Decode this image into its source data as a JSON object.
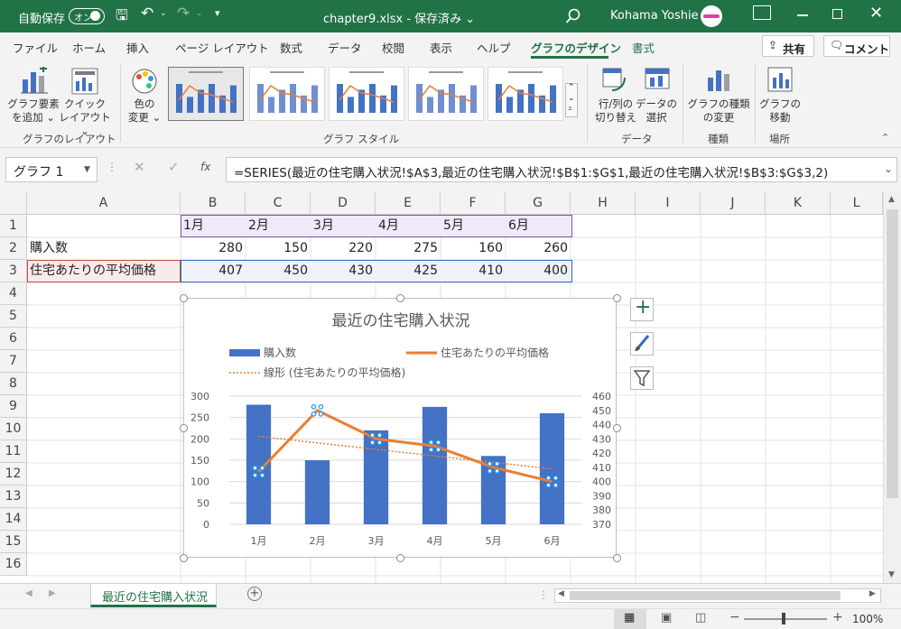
{
  "title_bar": {
    "autosave_label": "自動保存",
    "autosave_state": "オン",
    "filename": "chapter9.xlsx - 保存済み ⌄",
    "user": "Kohama Yoshie"
  },
  "menu": {
    "tabs": [
      "ファイル",
      "ホーム",
      "挿入",
      "ページ レイアウト",
      "数式",
      "データ",
      "校閲",
      "表示",
      "ヘルプ",
      "グラフのデザイン",
      "書式"
    ],
    "share": "共有",
    "comment": "コメント"
  },
  "ribbon": {
    "add_element": "グラフ要素\nを追加 ⌄",
    "quick_layout": "クイック\nレイアウト ⌄",
    "change_color": "色の\n変更 ⌄",
    "switch_rowcol": "行/列の\n切り替え",
    "select_data": "データの\n選択",
    "change_type": "グラフの種類\nの変更",
    "move_chart": "グラフの\n移動",
    "group_layout": "グラフのレイアウト",
    "group_style": "グラフ スタイル",
    "group_data": "データ",
    "group_type": "種類",
    "group_location": "場所"
  },
  "formula_bar": {
    "name_box": "グラフ 1",
    "fx": "fx",
    "formula": "=SERIES(最近の住宅購入状況!$A$3,最近の住宅購入状況!$B$1:$G$1,最近の住宅購入状況!$B$3:$G$3,2)"
  },
  "sheet": {
    "columns": [
      "A",
      "B",
      "C",
      "D",
      "E",
      "F",
      "G",
      "H",
      "I",
      "J",
      "K",
      "L"
    ],
    "rows": [
      "1",
      "2",
      "3",
      "4",
      "5",
      "6",
      "7",
      "8",
      "9",
      "10",
      "11",
      "12",
      "13",
      "14",
      "15",
      "16"
    ],
    "r1": [
      "1月",
      "2月",
      "3月",
      "4月",
      "5月",
      "6月"
    ],
    "r2_label": "購入数",
    "r2": [
      "280",
      "150",
      "220",
      "275",
      "160",
      "260"
    ],
    "r3_label": "住宅あたりの平均価格",
    "r3": [
      "407",
      "450",
      "430",
      "425",
      "410",
      "400"
    ]
  },
  "chart_data": {
    "type": "bar",
    "title": "最近の住宅購入状況",
    "categories": [
      "1月",
      "2月",
      "3月",
      "4月",
      "5月",
      "6月"
    ],
    "series": [
      {
        "name": "購入数",
        "type": "bar",
        "axis": "left",
        "values": [
          280,
          150,
          220,
          275,
          160,
          260
        ],
        "color": "#4472c4"
      },
      {
        "name": "住宅あたりの平均価格",
        "type": "line",
        "axis": "right",
        "values": [
          407,
          450,
          430,
          425,
          410,
          400
        ],
        "color": "#ed7d31"
      },
      {
        "name": "線形 (住宅あたりの平均価格)",
        "type": "trendline",
        "axis": "right",
        "color": "#ed7d31",
        "style": "dotted"
      }
    ],
    "y_left": {
      "ylim": [
        0,
        300
      ],
      "ticks": [
        "300",
        "250",
        "200",
        "150",
        "100",
        "50",
        "0"
      ]
    },
    "y_right": {
      "ylim": [
        370,
        460
      ],
      "ticks": [
        "460",
        "450",
        "440",
        "430",
        "420",
        "410",
        "400",
        "390",
        "380",
        "370"
      ]
    },
    "legend": "top",
    "grid": true
  },
  "tabs": {
    "sheet_name": "最近の住宅購入状況"
  },
  "status": {
    "zoom": "100%"
  },
  "colors": {
    "accent": "#217346",
    "bar": "#4472c4",
    "line": "#ed7d31"
  }
}
